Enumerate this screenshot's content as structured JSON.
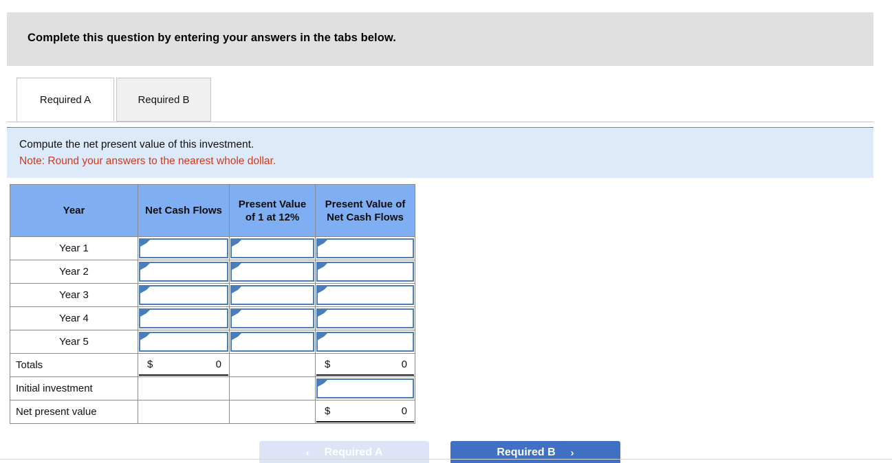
{
  "banner": {
    "text": "Complete this question by entering your answers in the tabs below."
  },
  "tabs": [
    {
      "label": "Required A",
      "active": true
    },
    {
      "label": "Required B",
      "active": false
    }
  ],
  "prompt": {
    "line1": "Compute the net present value of this investment.",
    "line2": "Note: Round your answers to the nearest whole dollar.",
    "note_color": "#d0391c"
  },
  "table": {
    "headers": [
      "Year",
      "Net Cash Flows",
      "Present Value of 1 at 12%",
      "Present Value of Net Cash Flows"
    ],
    "header_bg": "#80aef2",
    "rows": [
      {
        "label": "Year 1",
        "net_cash_flows": "",
        "pv_of_1": "",
        "pv_of_ncf": ""
      },
      {
        "label": "Year 2",
        "net_cash_flows": "",
        "pv_of_1": "",
        "pv_of_ncf": ""
      },
      {
        "label": "Year 3",
        "net_cash_flows": "",
        "pv_of_1": "",
        "pv_of_ncf": ""
      },
      {
        "label": "Year 4",
        "net_cash_flows": "",
        "pv_of_1": "",
        "pv_of_ncf": ""
      },
      {
        "label": "Year 5",
        "net_cash_flows": "",
        "pv_of_1": "",
        "pv_of_ncf": ""
      }
    ],
    "totals": {
      "label": "Totals",
      "net_cash_flows_symbol": "$",
      "net_cash_flows_value": "0",
      "pv_of_ncf_symbol": "$",
      "pv_of_ncf_value": "0"
    },
    "initial_investment": {
      "label": "Initial investment",
      "pv_of_ncf": ""
    },
    "net_present_value": {
      "label": "Net present value",
      "symbol": "$",
      "value": "0"
    }
  },
  "nav": {
    "prev_chevron": "‹",
    "prev_label": "Required A",
    "next_label": "Required B",
    "next_chevron": "›",
    "prev_bg": "#dce4f5",
    "next_bg": "#3f70c4"
  }
}
